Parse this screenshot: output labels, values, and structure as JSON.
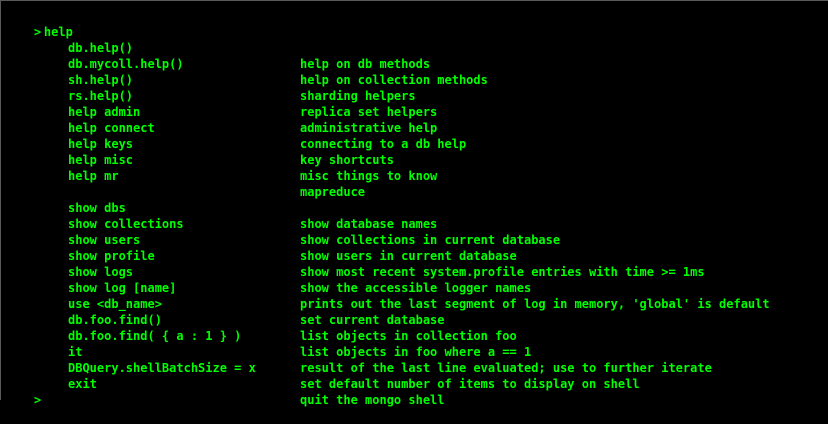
{
  "terminal": {
    "prompt_symbol": ">",
    "command": "help",
    "help_rows": [
      {
        "cmd": "db.help()",
        "desc": "help on db methods"
      },
      {
        "cmd": "db.mycoll.help()",
        "desc": "help on collection methods"
      },
      {
        "cmd": "sh.help()",
        "desc": "sharding helpers"
      },
      {
        "cmd": "rs.help()",
        "desc": "replica set helpers"
      },
      {
        "cmd": "help admin",
        "desc": "administrative help"
      },
      {
        "cmd": "help connect",
        "desc": "connecting to a db help"
      },
      {
        "cmd": "help keys",
        "desc": "key shortcuts"
      },
      {
        "cmd": "help misc",
        "desc": "misc things to know"
      },
      {
        "cmd": "help mr",
        "desc": "mapreduce"
      }
    ],
    "show_rows": [
      {
        "cmd": "show dbs",
        "desc": "show database names"
      },
      {
        "cmd": "show collections",
        "desc": "show collections in current database"
      },
      {
        "cmd": "show users",
        "desc": "show users in current database"
      },
      {
        "cmd": "show profile",
        "desc": "show most recent system.profile entries with time >= 1ms"
      },
      {
        "cmd": "show logs",
        "desc": "show the accessible logger names"
      },
      {
        "cmd": "show log [name]",
        "desc": "prints out the last segment of log in memory, 'global' is default"
      },
      {
        "cmd": "use <db_name>",
        "desc": "set current database"
      },
      {
        "cmd": "db.foo.find()",
        "desc": "list objects in collection foo"
      },
      {
        "cmd": "db.foo.find( { a : 1 } )",
        "desc": "list objects in foo where a == 1"
      },
      {
        "cmd": "it",
        "desc": "result of the last line evaluated; use to further iterate"
      },
      {
        "cmd": "DBQuery.shellBatchSize = x",
        "desc": "set default number of items to display on shell"
      },
      {
        "cmd": "exit",
        "desc": "quit the mongo shell"
      }
    ]
  },
  "colors": {
    "background": "#000000",
    "text": "#00ff00"
  }
}
